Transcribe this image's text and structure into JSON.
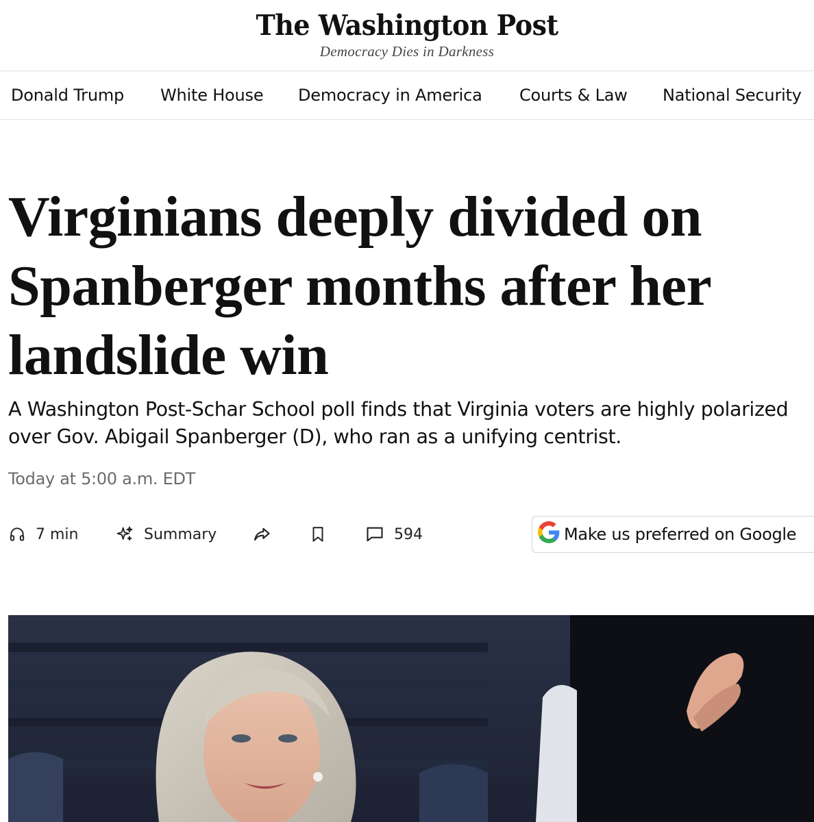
{
  "masthead": {
    "logo_text": "The Washington Post",
    "tagline": "Democracy Dies in Darkness"
  },
  "section_nav": {
    "items": [
      {
        "label": "Donald Trump"
      },
      {
        "label": "White House"
      },
      {
        "label": "Democracy in America"
      },
      {
        "label": "Courts & Law"
      },
      {
        "label": "National Security"
      }
    ]
  },
  "article": {
    "headline": "Virginians deeply divided on Spanberger months after her landslide win",
    "dek": "A Washington Post-Schar School poll finds that Virginia voters are highly polarized over Gov. Abigail Spanberger (D), who ran as a unifying centrist.",
    "timestamp": "Today at 5:00 a.m. EDT"
  },
  "actions": {
    "listen": {
      "icon": "headphones-icon",
      "label": "7 min"
    },
    "summary": {
      "icon": "sparkle-icon",
      "label": "Summary"
    },
    "share": {
      "icon": "share-icon"
    },
    "save": {
      "icon": "bookmark-icon"
    },
    "comments": {
      "icon": "comment-icon",
      "count": "594"
    },
    "google_preferred": {
      "icon": "google-g-icon",
      "label": "Make us preferred on Google"
    }
  },
  "colors": {
    "text": "#111111",
    "muted": "#6b6b6b",
    "divider": "#e2e2e2"
  }
}
